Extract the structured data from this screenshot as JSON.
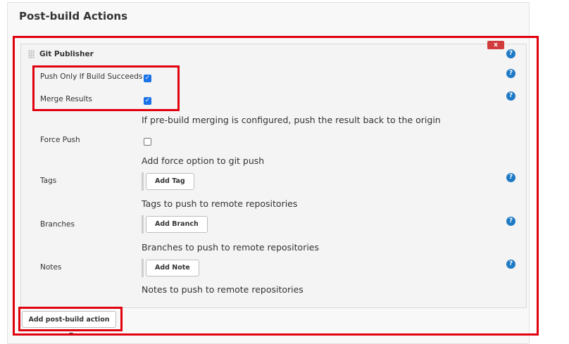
{
  "section": {
    "title": "Post-build Actions"
  },
  "publisher": {
    "title": "Git Publisher",
    "delete_label": "x",
    "help_glyph": "?"
  },
  "fields": {
    "push_only_if_success": {
      "label": "Push Only If Build Succeeds",
      "checked": true
    },
    "merge_results": {
      "label": "Merge Results",
      "checked": true,
      "description": "If pre-build merging is configured, push the result back to the origin"
    },
    "force_push": {
      "label": "Force Push",
      "checked": false,
      "description": "Add force option to git push"
    },
    "tags": {
      "label": "Tags",
      "button": "Add Tag",
      "description": "Tags to push to remote repositories"
    },
    "branches": {
      "label": "Branches",
      "button": "Add Branch",
      "description": "Branches to push to remote repositories"
    },
    "notes": {
      "label": "Notes",
      "button": "Add Note",
      "description": "Notes to push to remote repositories"
    }
  },
  "footer": {
    "add_post_build_action": "Add post-build action"
  },
  "colors": {
    "highlight": "#e0000f",
    "help": "#1f7ac6",
    "delete": "#d23c3c",
    "checkbox": "#1a73e8"
  }
}
